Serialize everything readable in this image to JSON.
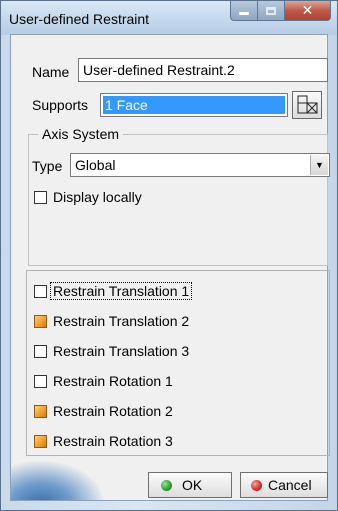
{
  "window": {
    "title": "User-defined Restraint"
  },
  "name": {
    "label": "Name",
    "value": "User-defined Restraint.2"
  },
  "supports": {
    "label": "Supports",
    "value": "1 Face"
  },
  "axis_system": {
    "title": "Axis System",
    "type_label": "Type",
    "type_value": "Global",
    "display_locally": {
      "label": "Display locally",
      "checked": false
    }
  },
  "restraints": [
    {
      "label": "Restrain Translation 1",
      "checked": false
    },
    {
      "label": "Restrain Translation 2",
      "checked": true
    },
    {
      "label": "Restrain Translation 3",
      "checked": false
    },
    {
      "label": "Restrain Rotation 1",
      "checked": false
    },
    {
      "label": "Restrain Rotation 2",
      "checked": true
    },
    {
      "label": "Restrain Rotation 3",
      "checked": true
    }
  ],
  "buttons": {
    "ok": "OK",
    "cancel": "Cancel"
  },
  "colors": {
    "selection": "#3399ff",
    "checked": "#f29b26",
    "ok_icon": "#2a9d2a",
    "cancel_icon": "#d42a2a"
  },
  "icons": {
    "supports_picker": "face-selection-icon",
    "close": "close-icon",
    "minimize": "minimize-icon",
    "maximize": "maximize-icon"
  }
}
